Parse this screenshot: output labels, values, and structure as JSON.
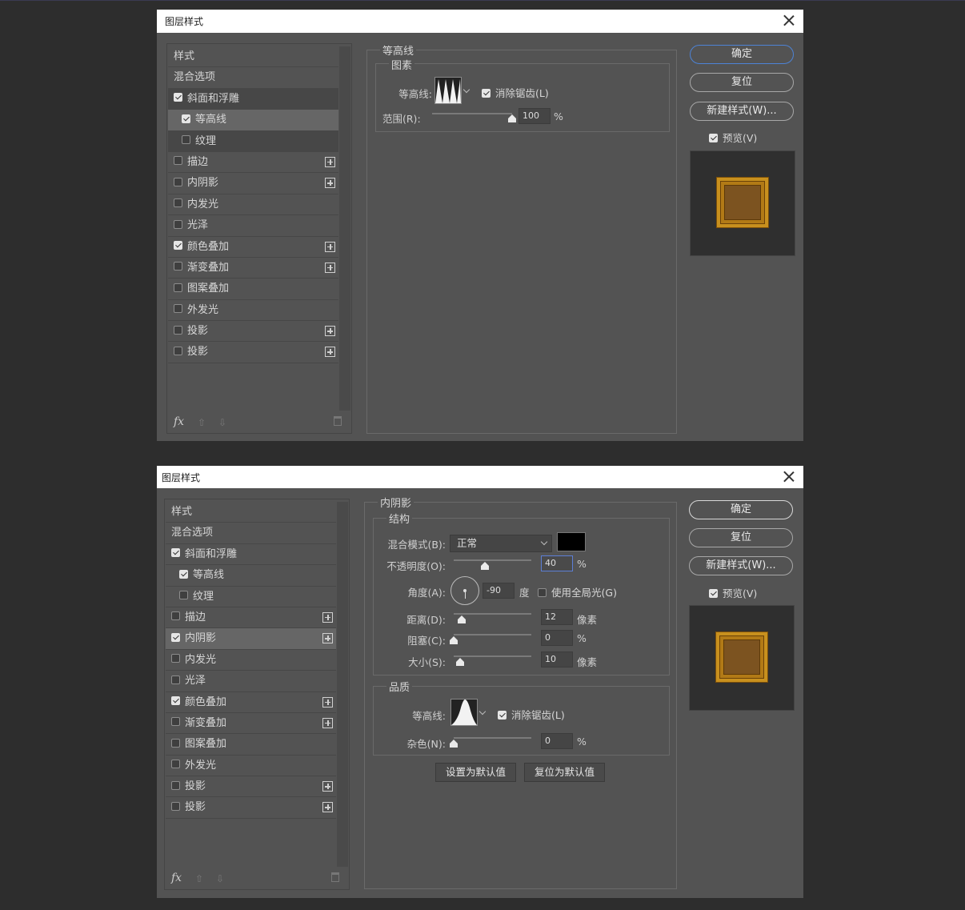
{
  "dialog1": {
    "title": "图层样式",
    "styles": [
      {
        "label": "样式",
        "checkbox": false,
        "checked": false,
        "plus": false
      },
      {
        "label": "混合选项",
        "checkbox": false,
        "checked": false,
        "plus": false
      },
      {
        "label": "斜面和浮雕",
        "checkbox": true,
        "checked": true,
        "plus": false,
        "selected": "dark"
      },
      {
        "label": "等高线",
        "checkbox": true,
        "checked": true,
        "plus": false,
        "sub": true,
        "selected": "light"
      },
      {
        "label": "纹理",
        "checkbox": true,
        "checked": false,
        "plus": false,
        "sub": true,
        "selected": "dark"
      },
      {
        "label": "描边",
        "checkbox": true,
        "checked": false,
        "plus": true
      },
      {
        "label": "内阴影",
        "checkbox": true,
        "checked": false,
        "plus": true
      },
      {
        "label": "内发光",
        "checkbox": true,
        "checked": false,
        "plus": false
      },
      {
        "label": "光泽",
        "checkbox": true,
        "checked": false,
        "plus": false
      },
      {
        "label": "颜色叠加",
        "checkbox": true,
        "checked": true,
        "plus": true
      },
      {
        "label": "渐变叠加",
        "checkbox": true,
        "checked": false,
        "plus": true
      },
      {
        "label": "图案叠加",
        "checkbox": true,
        "checked": false,
        "plus": false
      },
      {
        "label": "外发光",
        "checkbox": true,
        "checked": false,
        "plus": false
      },
      {
        "label": "投影",
        "checkbox": true,
        "checked": false,
        "plus": true
      },
      {
        "label": "投影",
        "checkbox": true,
        "checked": false,
        "plus": true
      }
    ],
    "fx": "fx",
    "section_title": "等高线",
    "sub_title": "图素",
    "contour_label": "等高线:",
    "antialias_label": "消除锯齿(L)",
    "antialias_checked": true,
    "range_label": "范围(R):",
    "range_value": "100",
    "range_fraction": 1.0,
    "percent": "%",
    "buttons": {
      "ok": "确定",
      "reset": "复位",
      "new_style": "新建样式(W)..."
    },
    "preview_label": "预览(V)",
    "preview_checked": true
  },
  "dialog2": {
    "title": "图层样式",
    "styles": [
      {
        "label": "样式",
        "checkbox": false,
        "checked": false,
        "plus": false
      },
      {
        "label": "混合选项",
        "checkbox": false,
        "checked": false,
        "plus": false
      },
      {
        "label": "斜面和浮雕",
        "checkbox": true,
        "checked": true,
        "plus": false
      },
      {
        "label": "等高线",
        "checkbox": true,
        "checked": true,
        "plus": false,
        "sub": true
      },
      {
        "label": "纹理",
        "checkbox": true,
        "checked": false,
        "plus": false,
        "sub": true
      },
      {
        "label": "描边",
        "checkbox": true,
        "checked": false,
        "plus": true
      },
      {
        "label": "内阴影",
        "checkbox": true,
        "checked": true,
        "plus": true,
        "selected": "light"
      },
      {
        "label": "内发光",
        "checkbox": true,
        "checked": false,
        "plus": false
      },
      {
        "label": "光泽",
        "checkbox": true,
        "checked": false,
        "plus": false
      },
      {
        "label": "颜色叠加",
        "checkbox": true,
        "checked": true,
        "plus": true
      },
      {
        "label": "渐变叠加",
        "checkbox": true,
        "checked": false,
        "plus": true
      },
      {
        "label": "图案叠加",
        "checkbox": true,
        "checked": false,
        "plus": false
      },
      {
        "label": "外发光",
        "checkbox": true,
        "checked": false,
        "plus": false
      },
      {
        "label": "投影",
        "checkbox": true,
        "checked": false,
        "plus": true
      },
      {
        "label": "投影",
        "checkbox": true,
        "checked": false,
        "plus": true
      }
    ],
    "fx": "fx",
    "section_title": "内阴影",
    "structure_title": "结构",
    "blend_mode_label": "混合模式(B):",
    "blend_mode_value": "正常",
    "shadow_color": "#000000",
    "opacity_label": "不透明度(O):",
    "opacity_value": "40",
    "opacity_fraction": 0.4,
    "angle_label": "角度(A):",
    "angle_value": "-90",
    "degree_unit": "度",
    "global_light_label": "使用全局光(G)",
    "global_light_checked": false,
    "distance_label": "距离(D):",
    "distance_value": "12",
    "distance_fraction": 0.1,
    "choke_label": "阻塞(C):",
    "choke_value": "0",
    "choke_fraction": 0.0,
    "size_label": "大小(S):",
    "size_value": "10",
    "size_fraction": 0.08,
    "pixel_unit": "像素",
    "percent": "%",
    "quality_title": "品质",
    "contour_label": "等高线:",
    "antialias_label": "消除锯齿(L)",
    "antialias_checked": true,
    "noise_label": "杂色(N):",
    "noise_value": "0",
    "noise_fraction": 0.0,
    "make_default": "设置为默认值",
    "reset_default": "复位为默认值",
    "buttons": {
      "ok": "确定",
      "reset": "复位",
      "new_style": "新建样式(W)..."
    },
    "preview_label": "预览(V)",
    "preview_checked": true
  }
}
